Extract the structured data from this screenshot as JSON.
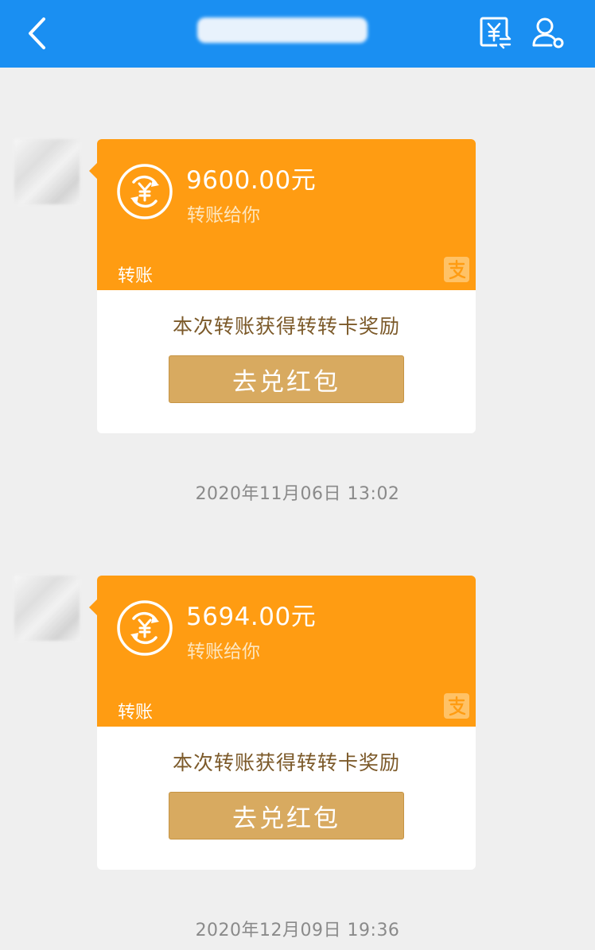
{
  "nav": {
    "title": "",
    "back_icon": "chevron-left-icon",
    "transfer_icon": "yuan-transfer-icon",
    "profile_icon": "user-settings-icon"
  },
  "colors": {
    "nav_bg": "#1a8ff2",
    "card_orange": "#ff9c12",
    "button_gold": "#d8aa60",
    "reward_text": "#7c5a2a",
    "page_bg": "#efefef"
  },
  "messages": [
    {
      "amount": "9600.00元",
      "desc": "转账给你",
      "type_label": "转账",
      "reward_text": "本次转账获得转转卡奖励",
      "button_label": "去兑红包",
      "timestamp": "2020年11月06日 13:02"
    },
    {
      "amount": "5694.00元",
      "desc": "转账给你",
      "type_label": "转账",
      "reward_text": "本次转账获得转转卡奖励",
      "button_label": "去兑红包",
      "timestamp": "2020年12月09日 19:36"
    }
  ]
}
